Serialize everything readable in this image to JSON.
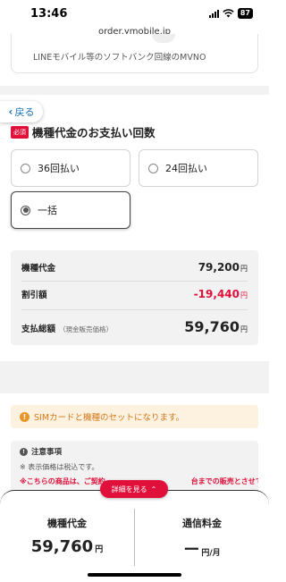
{
  "status_bar": {
    "time": "13:46",
    "battery": "87"
  },
  "browser": {
    "url": "order.ymobile.jp"
  },
  "prev_section": {
    "text": "LINEモバイル等のソフトバンク回線のMVNO"
  },
  "back_button": {
    "label": "戻る"
  },
  "payment_section": {
    "required_badge": "必須",
    "title": "機種代金のお支払い回数",
    "options": [
      {
        "label": "36回払い",
        "selected": false
      },
      {
        "label": "24回払い",
        "selected": false
      },
      {
        "label": "一括",
        "selected": true
      }
    ]
  },
  "summary": {
    "device_price_label": "機種代金",
    "device_price_value": "79,200",
    "discount_label": "割引額",
    "discount_value": "-19,440",
    "total_label": "支払総額",
    "total_sub": "（現金販売価格）",
    "total_value": "59,760",
    "yen": "円"
  },
  "notice": {
    "text": "SIMカードと機種のセットになります。"
  },
  "caution": {
    "title": "注意事項",
    "line1": "※ 表示価格は税込です。",
    "line2": "※こちらの商品は、ご契約",
    "line2_tail": "台までの販売とさせてい"
  },
  "detail_button": {
    "label": "詳細を見る"
  },
  "footer": {
    "device_label": "機種代金",
    "device_value": "59,760",
    "device_unit": "円",
    "comm_label": "通信料金",
    "comm_value": "ー",
    "comm_unit": "円/月"
  },
  "colors": {
    "accent_red": "#e0103b",
    "link_blue": "#1a73b8",
    "notice_orange": "#d47a1a"
  }
}
